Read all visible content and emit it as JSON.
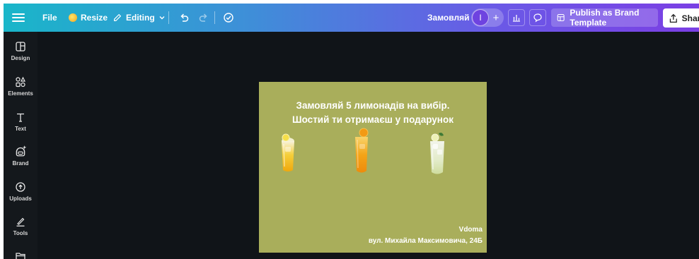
{
  "topbar": {
    "file_label": "File",
    "resize_label": "Resize",
    "editing_label": "Editing",
    "design_title": "Замовляй",
    "avatar_initial": "I",
    "plus_symbol": "+",
    "publish_label": "Publish as Brand Template",
    "share_label": "Share",
    "gradient_colors": [
      "#19b6c9",
      "#3e8fd8",
      "#6a5ae6",
      "#7b3fe4"
    ]
  },
  "sidebar": {
    "items": [
      {
        "label": "Design",
        "icon": "design-icon"
      },
      {
        "label": "Elements",
        "icon": "elements-icon"
      },
      {
        "label": "Text",
        "icon": "text-icon"
      },
      {
        "label": "Brand",
        "icon": "brand-icon"
      },
      {
        "label": "Uploads",
        "icon": "uploads-icon"
      },
      {
        "label": "Tools",
        "icon": "tools-icon"
      },
      {
        "label": "",
        "icon": "folder-icon"
      }
    ]
  },
  "canvas": {
    "background_color": "#a9ae5b",
    "headline_line1": "Замовляй 5 лимонадів на вибір.",
    "headline_line2": "Шостий ти отримаєш у подарунок",
    "brand_name": "Vdoma",
    "address": "вул. Михайла Максимовича, 24Б",
    "glasses": [
      {
        "name": "lemon-lemonade",
        "color": "#f3b818"
      },
      {
        "name": "orange-lemonade",
        "color": "#f09a12"
      },
      {
        "name": "mint-lemonade",
        "color": "#dfe7c2"
      }
    ]
  }
}
